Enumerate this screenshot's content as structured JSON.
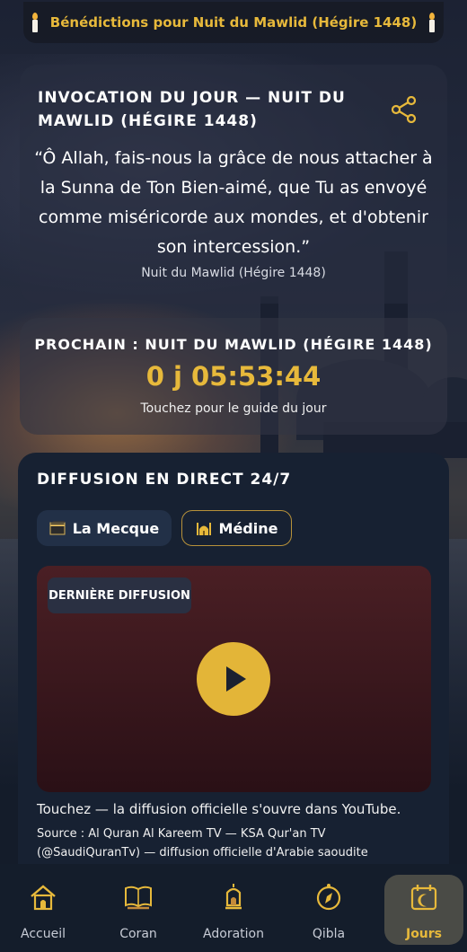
{
  "banner": {
    "text": "Bénédictions pour Nuit du Mawlid (Hégire 1448)"
  },
  "invocation": {
    "title": "INVOCATION DU JOUR — NUIT DU MAWLID (HÉGIRE 1448)",
    "quote": "“Ô Allah, fais-nous la grâce de nous attacher à la Sunna de Ton Bien-aimé, que Tu as envoyé comme miséricorde aux mondes, et d'obtenir son intercession.”",
    "source": "Nuit du Mawlid (Hégire 1448)",
    "share_icon": "share-icon"
  },
  "countdown": {
    "label": "PROCHAIN : NUIT DU MAWLID (HÉGIRE 1448)",
    "timer": "0 j 05:53:44",
    "hint": "Touchez pour le guide du jour"
  },
  "live": {
    "title": "DIFFUSION EN DIRECT 24/7",
    "tabs": [
      {
        "label": "La Mecque",
        "icon": "kaaba-icon",
        "selected": false
      },
      {
        "label": "Médine",
        "icon": "mosque-icon",
        "selected": true
      }
    ],
    "video_badge": "DERNIÈRE DIFFUSION",
    "hint": "Touchez — la diffusion officielle s'ouvre dans YouTube.",
    "source": "Source : Al Quran Al Kareem TV — KSA Qur'an TV (@SaudiQuranTv) — diffusion officielle d'Arabie saoudite"
  },
  "nav": {
    "items": [
      {
        "label": "Accueil",
        "icon": "home-icon"
      },
      {
        "label": "Coran",
        "icon": "quran-icon"
      },
      {
        "label": "Adoration",
        "icon": "lantern-icon"
      },
      {
        "label": "Qibla",
        "icon": "compass-icon"
      },
      {
        "label": "Jours",
        "icon": "calendar-icon",
        "active": true
      }
    ]
  },
  "colors": {
    "accent": "#e7b93b",
    "card": "#172132",
    "nav": "#141d2b"
  }
}
